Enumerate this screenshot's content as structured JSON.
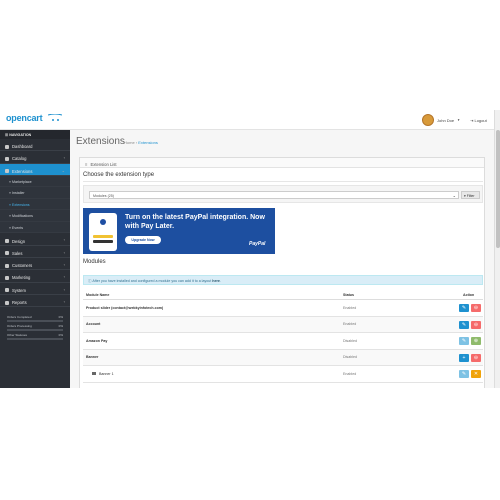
{
  "header": {
    "logo_text": "opencart",
    "user_name": "John Doe",
    "logout_label": "Logout"
  },
  "sidebar": {
    "heading": "NAVIGATION",
    "items": [
      {
        "label": "Dashboard",
        "icon": "dashboard-icon"
      },
      {
        "label": "Catalog",
        "icon": "tag-icon"
      },
      {
        "label": "Extensions",
        "icon": "puzzle-icon",
        "active": true
      }
    ],
    "sub_items": [
      {
        "label": "Marketplace"
      },
      {
        "label": "Installer"
      },
      {
        "label": "Extensions",
        "active": true
      },
      {
        "label": "Modifications"
      },
      {
        "label": "Events"
      }
    ],
    "items_after": [
      {
        "label": "Design",
        "icon": "monitor-icon"
      },
      {
        "label": "Sales",
        "icon": "cart-icon"
      },
      {
        "label": "Customers",
        "icon": "user-icon"
      },
      {
        "label": "Marketing",
        "icon": "share-icon"
      },
      {
        "label": "System",
        "icon": "gear-icon"
      },
      {
        "label": "Reports",
        "icon": "chart-icon"
      }
    ],
    "stats": [
      {
        "label": "Orders Completed",
        "value": "0%",
        "fraction": 0
      },
      {
        "label": "Orders Processing",
        "value": "0%",
        "fraction": 0
      },
      {
        "label": "Other Statuses",
        "value": "0%",
        "fraction": 0
      }
    ]
  },
  "page": {
    "title": "Extensions",
    "breadcrumb_home": "Home",
    "breadcrumb_sep": "›",
    "breadcrumb_current": "Extensions"
  },
  "panel": {
    "heading": "Extension List",
    "choose_label": "Choose the extension type",
    "select_value": "Modules (25)",
    "filter_label": "Filter"
  },
  "banner": {
    "title": "Turn on the latest PayPal integration. Now with Pay Later.",
    "button": "Upgrade Now",
    "brand": "PayPal"
  },
  "modules": {
    "title": "Modules",
    "alert_text": "After you have installed and configured a module you can add it to a layout",
    "alert_link": "here",
    "columns": [
      "Module Name",
      "Status",
      "Action"
    ],
    "rows": [
      {
        "name": "Product slider (contact@webkyinfotech.com)",
        "status": "Enabled",
        "actions": [
          "edit",
          "delete"
        ]
      },
      {
        "name": "Account",
        "status": "Enabled",
        "actions": [
          "edit",
          "delete"
        ]
      },
      {
        "name": "Amazon Pay",
        "status": "Disabled",
        "actions": [
          "edit-light",
          "add"
        ]
      },
      {
        "name": "Banner",
        "status": "Disabled",
        "actions": [
          "edit",
          "delete"
        ]
      },
      {
        "name": "Banner 1",
        "status": "Enabled",
        "actions": [
          "edit-light",
          "warn"
        ],
        "child": true
      }
    ]
  }
}
